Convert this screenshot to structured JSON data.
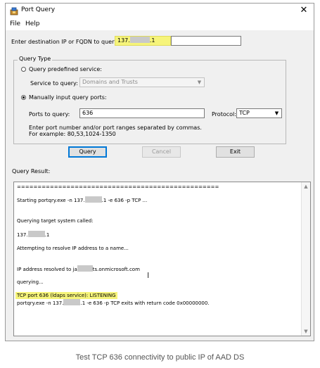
{
  "window": {
    "title": "Port Query",
    "close_glyph": "✕",
    "menu": [
      "File",
      "Help"
    ]
  },
  "destination": {
    "label": "Enter destination IP or FQDN to query:",
    "value_prefix": "137.",
    "value_suffix": ".1"
  },
  "query_type": {
    "legend": "Query Type",
    "predefined_label": "Query predefined service:",
    "service_label": "Service to query:",
    "service_value": "Domains and Trusts",
    "manual_label": "Manually input query ports:",
    "ports_label": "Ports to query:",
    "ports_value": "636",
    "protocol_label": "Protocol:",
    "protocol_value": "TCP",
    "help_line1": "Enter port number and/or port ranges separated by commas.",
    "help_line2": "For example: 80,53,1024-1350"
  },
  "buttons": {
    "query": "Query",
    "cancel": "Cancel",
    "exit": "Exit"
  },
  "result": {
    "label": "Query Result:",
    "separator": "=================================================",
    "l_start_pre": "Starting portqry.exe -n 137.",
    "l_start_post": ".1 -e 636 -p TCP ...",
    "l_querying_target": "Querying target system called:",
    "l_target_pre": "137.",
    "l_target_post": ".1",
    "l_resolve": "Attempting to resolve IP address to a name...",
    "l_resolved_pre": "IP address resolved to ja",
    "l_resolved_post": "ts.onmicrosoft.com",
    "l_querying": "querying...",
    "l_listening": "TCP port 636 (ldaps service): LISTENING",
    "l_exit_pre": "portqry.exe -n 137.",
    "l_exit_post": ".1 -e 636 -p TCP exits with return code 0x00000000."
  },
  "caption": "Test TCP 636 connectivity to public IP of AAD DS",
  "colors": {
    "highlight": "#f6f47a",
    "default_button_border": "#0078d7"
  }
}
